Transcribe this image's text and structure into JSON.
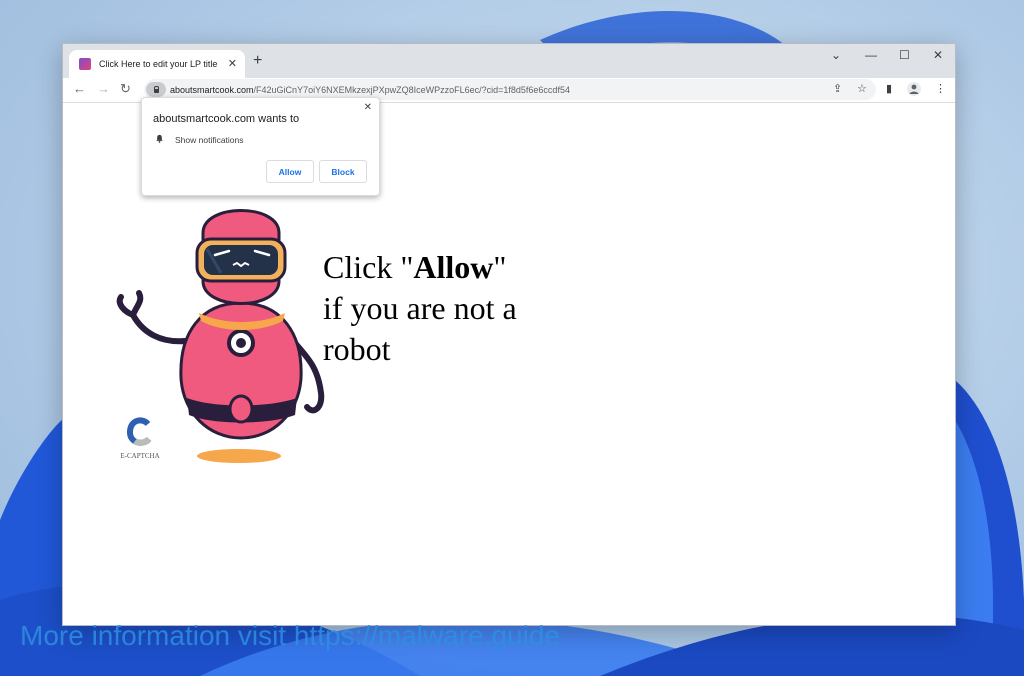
{
  "browser": {
    "tab_title": "Click Here to edit your LP title",
    "tab_close": "✕",
    "new_tab": "+",
    "window_controls": {
      "dropdown": "⌄",
      "minimize": "—",
      "maximize": "☐",
      "close": "✕"
    },
    "nav": {
      "back": "←",
      "forward": "→",
      "reload": "↻"
    },
    "url_host": "aboutsmartcook.com",
    "url_path": "/F42uGiCnY7oiY6NXEMkzexjPXpwZQ8IceWPzzoFL6ec/?cid=1f8d5f6e6ccdf54",
    "toolbar_icons": {
      "share": "⇪",
      "bookmark": "☆",
      "sidebar": "▮",
      "menu": "⋮"
    }
  },
  "notification_prompt": {
    "heading": "aboutsmartcook.com wants to",
    "permission": "Show notifications",
    "allow_label": "Allow",
    "block_label": "Block",
    "close": "✕"
  },
  "page": {
    "headline_pre": "Click \"",
    "headline_bold": "Allow",
    "headline_post": "\"",
    "headline_line2": "if you are not a",
    "headline_line3": "robot",
    "captcha_label": "E-CAPTCHA",
    "robot_colors": {
      "body": "#f05a7e",
      "visor": "#f2b25c",
      "outline": "#2a1e3d",
      "shadow": "#f6a64b"
    }
  },
  "watermark": "More information visit https://malware.guide"
}
